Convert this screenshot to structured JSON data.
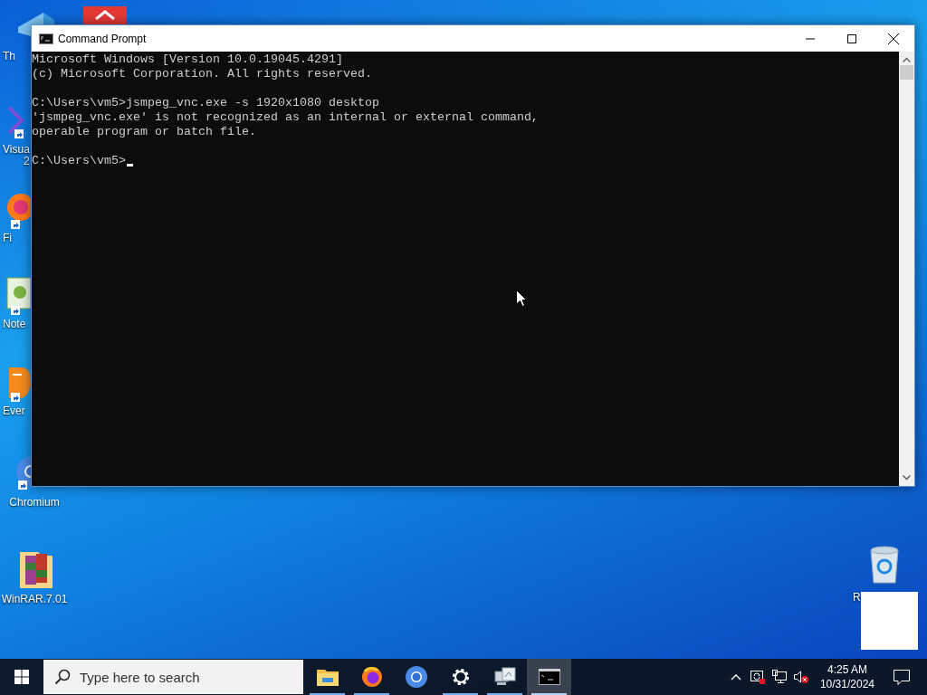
{
  "desktop_icons": [
    {
      "kind": "pc",
      "label_lines": [
        "Th"
      ]
    },
    {
      "kind": "red-app"
    },
    {
      "kind": "vs",
      "label_lines": [
        "Visua",
        "2"
      ]
    },
    {
      "kind": "firefox",
      "label_lines": [
        "Fi"
      ]
    },
    {
      "kind": "notepad",
      "label_lines": [
        "Note"
      ]
    },
    {
      "kind": "evernote",
      "label_lines": [
        "Ever"
      ]
    },
    {
      "kind": "chromium",
      "label_lines": [
        "Chromium"
      ]
    },
    {
      "kind": "winrar",
      "label_lines": [
        "WinRAR.7.01"
      ]
    }
  ],
  "recycle_bin": {
    "label": "R"
  },
  "window": {
    "title": "Command Prompt",
    "blocks": [
      [
        "Microsoft Windows [Version 10.0.19045.4291]",
        "(c) Microsoft Corporation. All rights reserved."
      ],
      [
        "C:\\Users\\vm5>jsmpeg_vnc.exe -s 1920x1080 desktop",
        "'jsmpeg_vnc.exe' is not recognized as an internal or external command,",
        "operable program or batch file."
      ]
    ],
    "prompt": "C:\\Users\\vm5>"
  },
  "taskbar": {
    "search": {
      "placeholder": "Type here to search"
    },
    "apps": [
      {
        "kind": "explorer",
        "running": true,
        "selected": false
      },
      {
        "kind": "firefox",
        "running": true,
        "selected": false
      },
      {
        "kind": "chromium",
        "running": false,
        "selected": false
      },
      {
        "kind": "settings",
        "running": true,
        "selected": false
      },
      {
        "kind": "network",
        "running": true,
        "selected": false
      },
      {
        "kind": "console",
        "running": true,
        "selected": true
      }
    ],
    "clock": {
      "time": "4:25 AM",
      "date": "10/31/2024"
    }
  }
}
